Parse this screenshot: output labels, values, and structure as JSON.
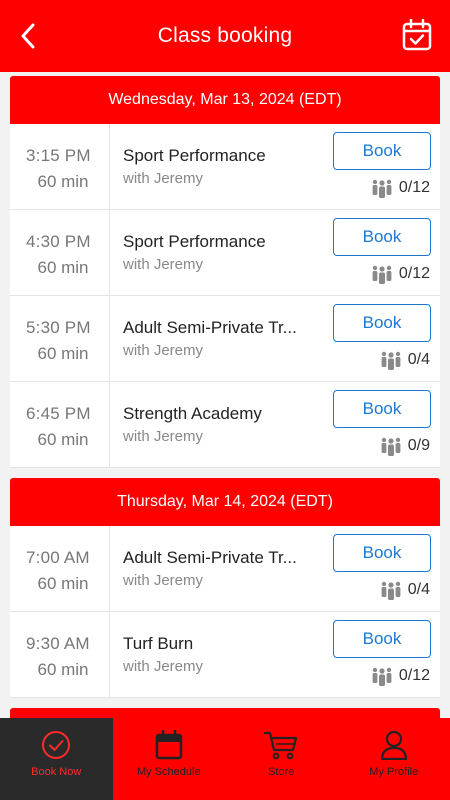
{
  "header": {
    "title": "Class booking",
    "back_icon": "chevron-left-icon",
    "calendar_icon": "calendar-check-icon"
  },
  "sections": [
    {
      "date": "Wednesday, Mar 13, 2024 (EDT)",
      "classes": [
        {
          "time": "3:15  PM",
          "duration": "60 min",
          "name": "Sport Performance",
          "instructor": "with Jeremy",
          "book_label": "Book",
          "capacity": "0/12"
        },
        {
          "time": "4:30  PM",
          "duration": "60 min",
          "name": "Sport Performance",
          "instructor": "with Jeremy",
          "book_label": "Book",
          "capacity": "0/12"
        },
        {
          "time": "5:30  PM",
          "duration": "60 min",
          "name": "Adult Semi-Private Tr...",
          "instructor": "with Jeremy",
          "book_label": "Book",
          "capacity": "0/4"
        },
        {
          "time": "6:45  PM",
          "duration": "60 min",
          "name": "Strength Academy",
          "instructor": "with Jeremy",
          "book_label": "Book",
          "capacity": "0/9"
        }
      ]
    },
    {
      "date": "Thursday, Mar 14, 2024 (EDT)",
      "classes": [
        {
          "time": "7:00  AM",
          "duration": "60 min",
          "name": "Adult Semi-Private Tr...",
          "instructor": "with Jeremy",
          "book_label": "Book",
          "capacity": "0/4"
        },
        {
          "time": "9:30  AM",
          "duration": "60 min",
          "name": "Turf Burn",
          "instructor": "with Jeremy",
          "book_label": "Book",
          "capacity": "0/12"
        }
      ]
    }
  ],
  "tabs": [
    {
      "label": "Book Now",
      "icon": "check-circle-icon",
      "active": true
    },
    {
      "label": "My Schedule",
      "icon": "calendar-icon",
      "active": false
    },
    {
      "label": "Store",
      "icon": "cart-icon",
      "active": false
    },
    {
      "label": "My Profile",
      "icon": "user-icon",
      "active": false
    }
  ],
  "colors": {
    "brand": "#ff0000",
    "book_button": "#1e78d2",
    "active_tab_bg": "#2a2a2a"
  }
}
